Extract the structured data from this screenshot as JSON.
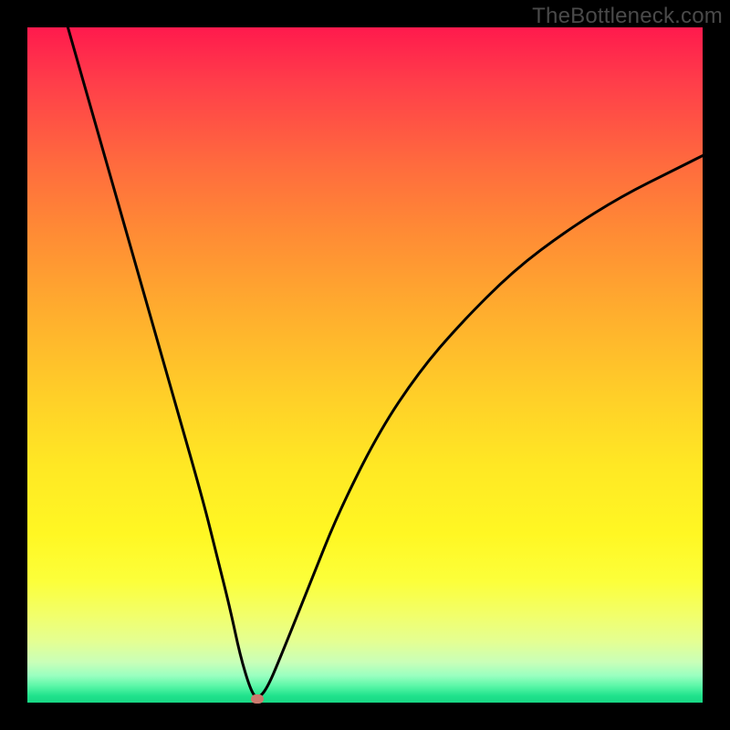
{
  "watermark": "TheBottleneck.com",
  "chart_data": {
    "type": "line",
    "title": "",
    "xlabel": "",
    "ylabel": "",
    "xlim": [
      0,
      100
    ],
    "ylim": [
      0,
      100
    ],
    "gradient_meaning": "vertical axis shades from red (top, high bottleneck) through orange/yellow to green (bottom, no bottleneck)",
    "series": [
      {
        "name": "bottleneck-curve",
        "x": [
          6,
          10,
          14,
          18,
          22,
          26,
          28,
          30,
          31.5,
          33,
          34,
          35.5,
          38,
          42,
          46,
          52,
          58,
          64,
          72,
          80,
          88,
          96,
          100
        ],
        "y": [
          100,
          86,
          72,
          58,
          44,
          30,
          22,
          14,
          7,
          2,
          0.5,
          2,
          8,
          18,
          28,
          40,
          49,
          56,
          64,
          70,
          75,
          79,
          81
        ]
      }
    ],
    "marker": {
      "x": 34,
      "y": 0.5,
      "color": "#cc7a6e"
    },
    "colors": {
      "frame": "#000000",
      "curve": "#000000",
      "gradient_top": "#ff1a4d",
      "gradient_bottom": "#18d884",
      "watermark": "#4a4a4a"
    }
  }
}
